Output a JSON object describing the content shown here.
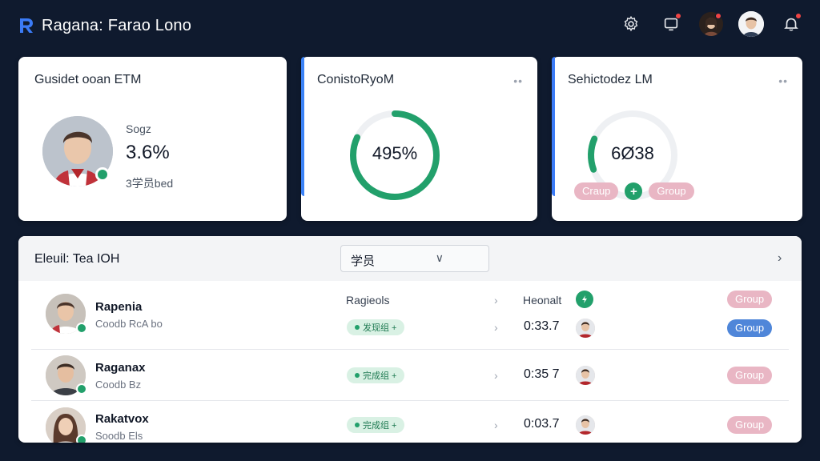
{
  "header": {
    "app_title": "Ragana: Farao Lono",
    "icons": [
      "settings-icon",
      "monitor-icon",
      "user-avatar",
      "user-avatar",
      "bell-icon"
    ]
  },
  "cards": {
    "profile": {
      "title": "Gusidet ooan ETM",
      "stat_label": "Sogz",
      "stat_value": "3.6%",
      "stat_sub": "3学员bed"
    },
    "progress": {
      "title": "ConistoRyoM",
      "menu": "••",
      "percent_text": "495%",
      "progress_fraction": 0.82
    },
    "selector": {
      "title": "Sehictodez LM",
      "menu": "••",
      "value_text": "6Ø38",
      "left_pill": "Craup",
      "right_pill": "Group",
      "progress_fraction": 0.12
    }
  },
  "list": {
    "title": "Eleuil: Tea IOH",
    "filter_value": "学员",
    "filter_caret": "∨",
    "col_header_a": "Ragieols",
    "col_header_b": "Heonalt",
    "header_pill": "Group",
    "rows": [
      {
        "name": "Rapenia",
        "sub": "Coodb RcA bo",
        "tag": "发现组 +",
        "time": "0:33.7",
        "pill": "Group",
        "pill_color": "blue"
      },
      {
        "name": "Raganax",
        "sub": "Coodb Bz",
        "tag": "完成组 +",
        "time": "0:35 7",
        "pill": "Group",
        "pill_color": "pink"
      },
      {
        "name": "Rakatvox",
        "sub": "Soodb Els",
        "tag": "完成组 +",
        "time": "0:03.7",
        "pill": "Group",
        "pill_color": "pink"
      }
    ]
  },
  "colors": {
    "background": "#0f1a2e",
    "accent_green": "#22a06b",
    "accent_blue": "#3b82f6",
    "pill_pink": "#e9b6c4",
    "pill_blue": "#4f86d9"
  }
}
